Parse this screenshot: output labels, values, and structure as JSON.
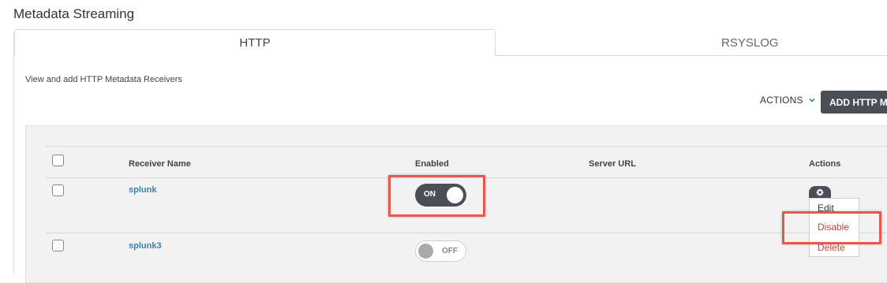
{
  "page": {
    "title": "Metadata Streaming"
  },
  "tabs": [
    {
      "label": "HTTP",
      "active": true
    },
    {
      "label": "RSYSLOG",
      "active": false
    }
  ],
  "description": "View and add HTTP Metadata Receivers",
  "toolbar": {
    "actions_label": "ACTIONS",
    "add_button_label": "ADD HTTP METADATA RECEIVER"
  },
  "table": {
    "headers": [
      "Receiver Name",
      "Enabled",
      "Server URL",
      "Actions"
    ],
    "rows": [
      {
        "name": "splunk",
        "enabled": true,
        "toggle_label": "ON",
        "server_url": ""
      },
      {
        "name": "splunk3",
        "enabled": false,
        "toggle_label": "OFF",
        "server_url": ""
      }
    ]
  },
  "row_menu": {
    "items": [
      "Edit",
      "Disable",
      "Delete"
    ]
  },
  "colors": {
    "accent_dark": "#4a4f57",
    "link": "#3d7fb4",
    "danger": "#c4453c",
    "highlight": "#e8574c"
  }
}
